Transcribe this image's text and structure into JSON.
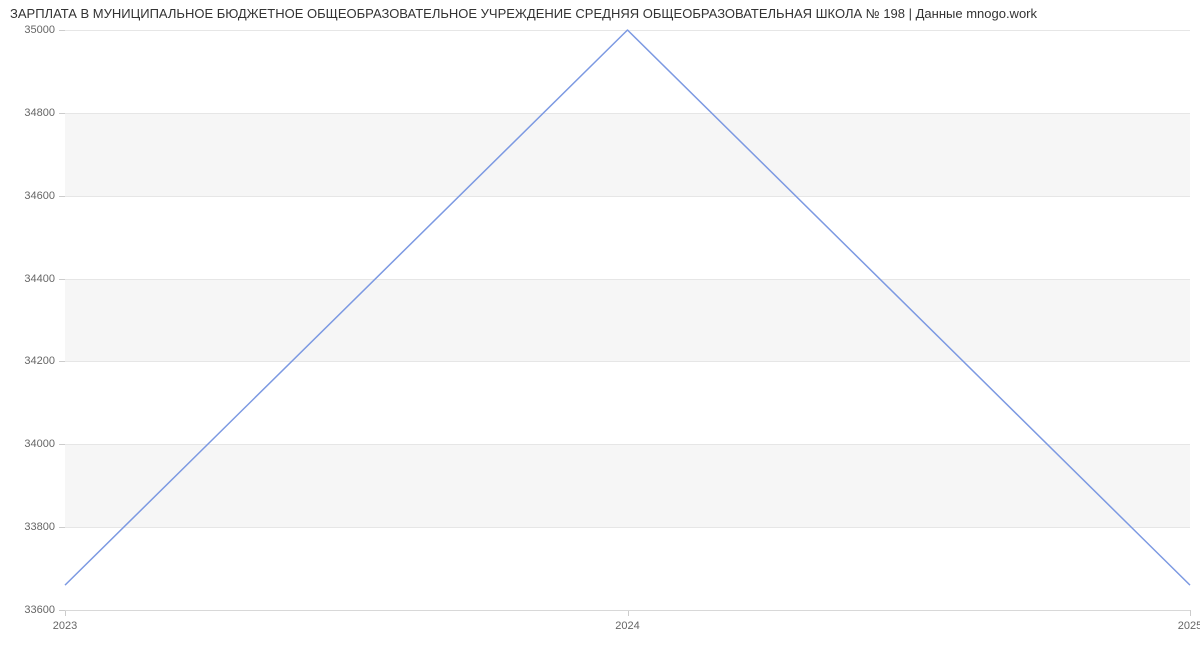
{
  "chart_data": {
    "type": "line",
    "title": "ЗАРПЛАТА В МУНИЦИПАЛЬНОЕ БЮДЖЕТНОЕ ОБЩЕОБРАЗОВАТЕЛЬНОЕ УЧРЕЖДЕНИЕ СРЕДНЯЯ ОБЩЕОБРАЗОВАТЕЛЬНАЯ ШКОЛА № 198 | Данные mnogo.work",
    "x": [
      2023,
      2024,
      2025
    ],
    "values": [
      33660,
      35000,
      33660
    ],
    "xlabel": "",
    "ylabel": "",
    "ylim": [
      33600,
      35000
    ],
    "y_ticks": [
      33600,
      33800,
      34000,
      34200,
      34400,
      34600,
      34800,
      35000
    ],
    "x_ticks": [
      2023,
      2024,
      2025
    ],
    "line_color": "#7c99e2",
    "grid_band_color": "#f6f6f6"
  }
}
